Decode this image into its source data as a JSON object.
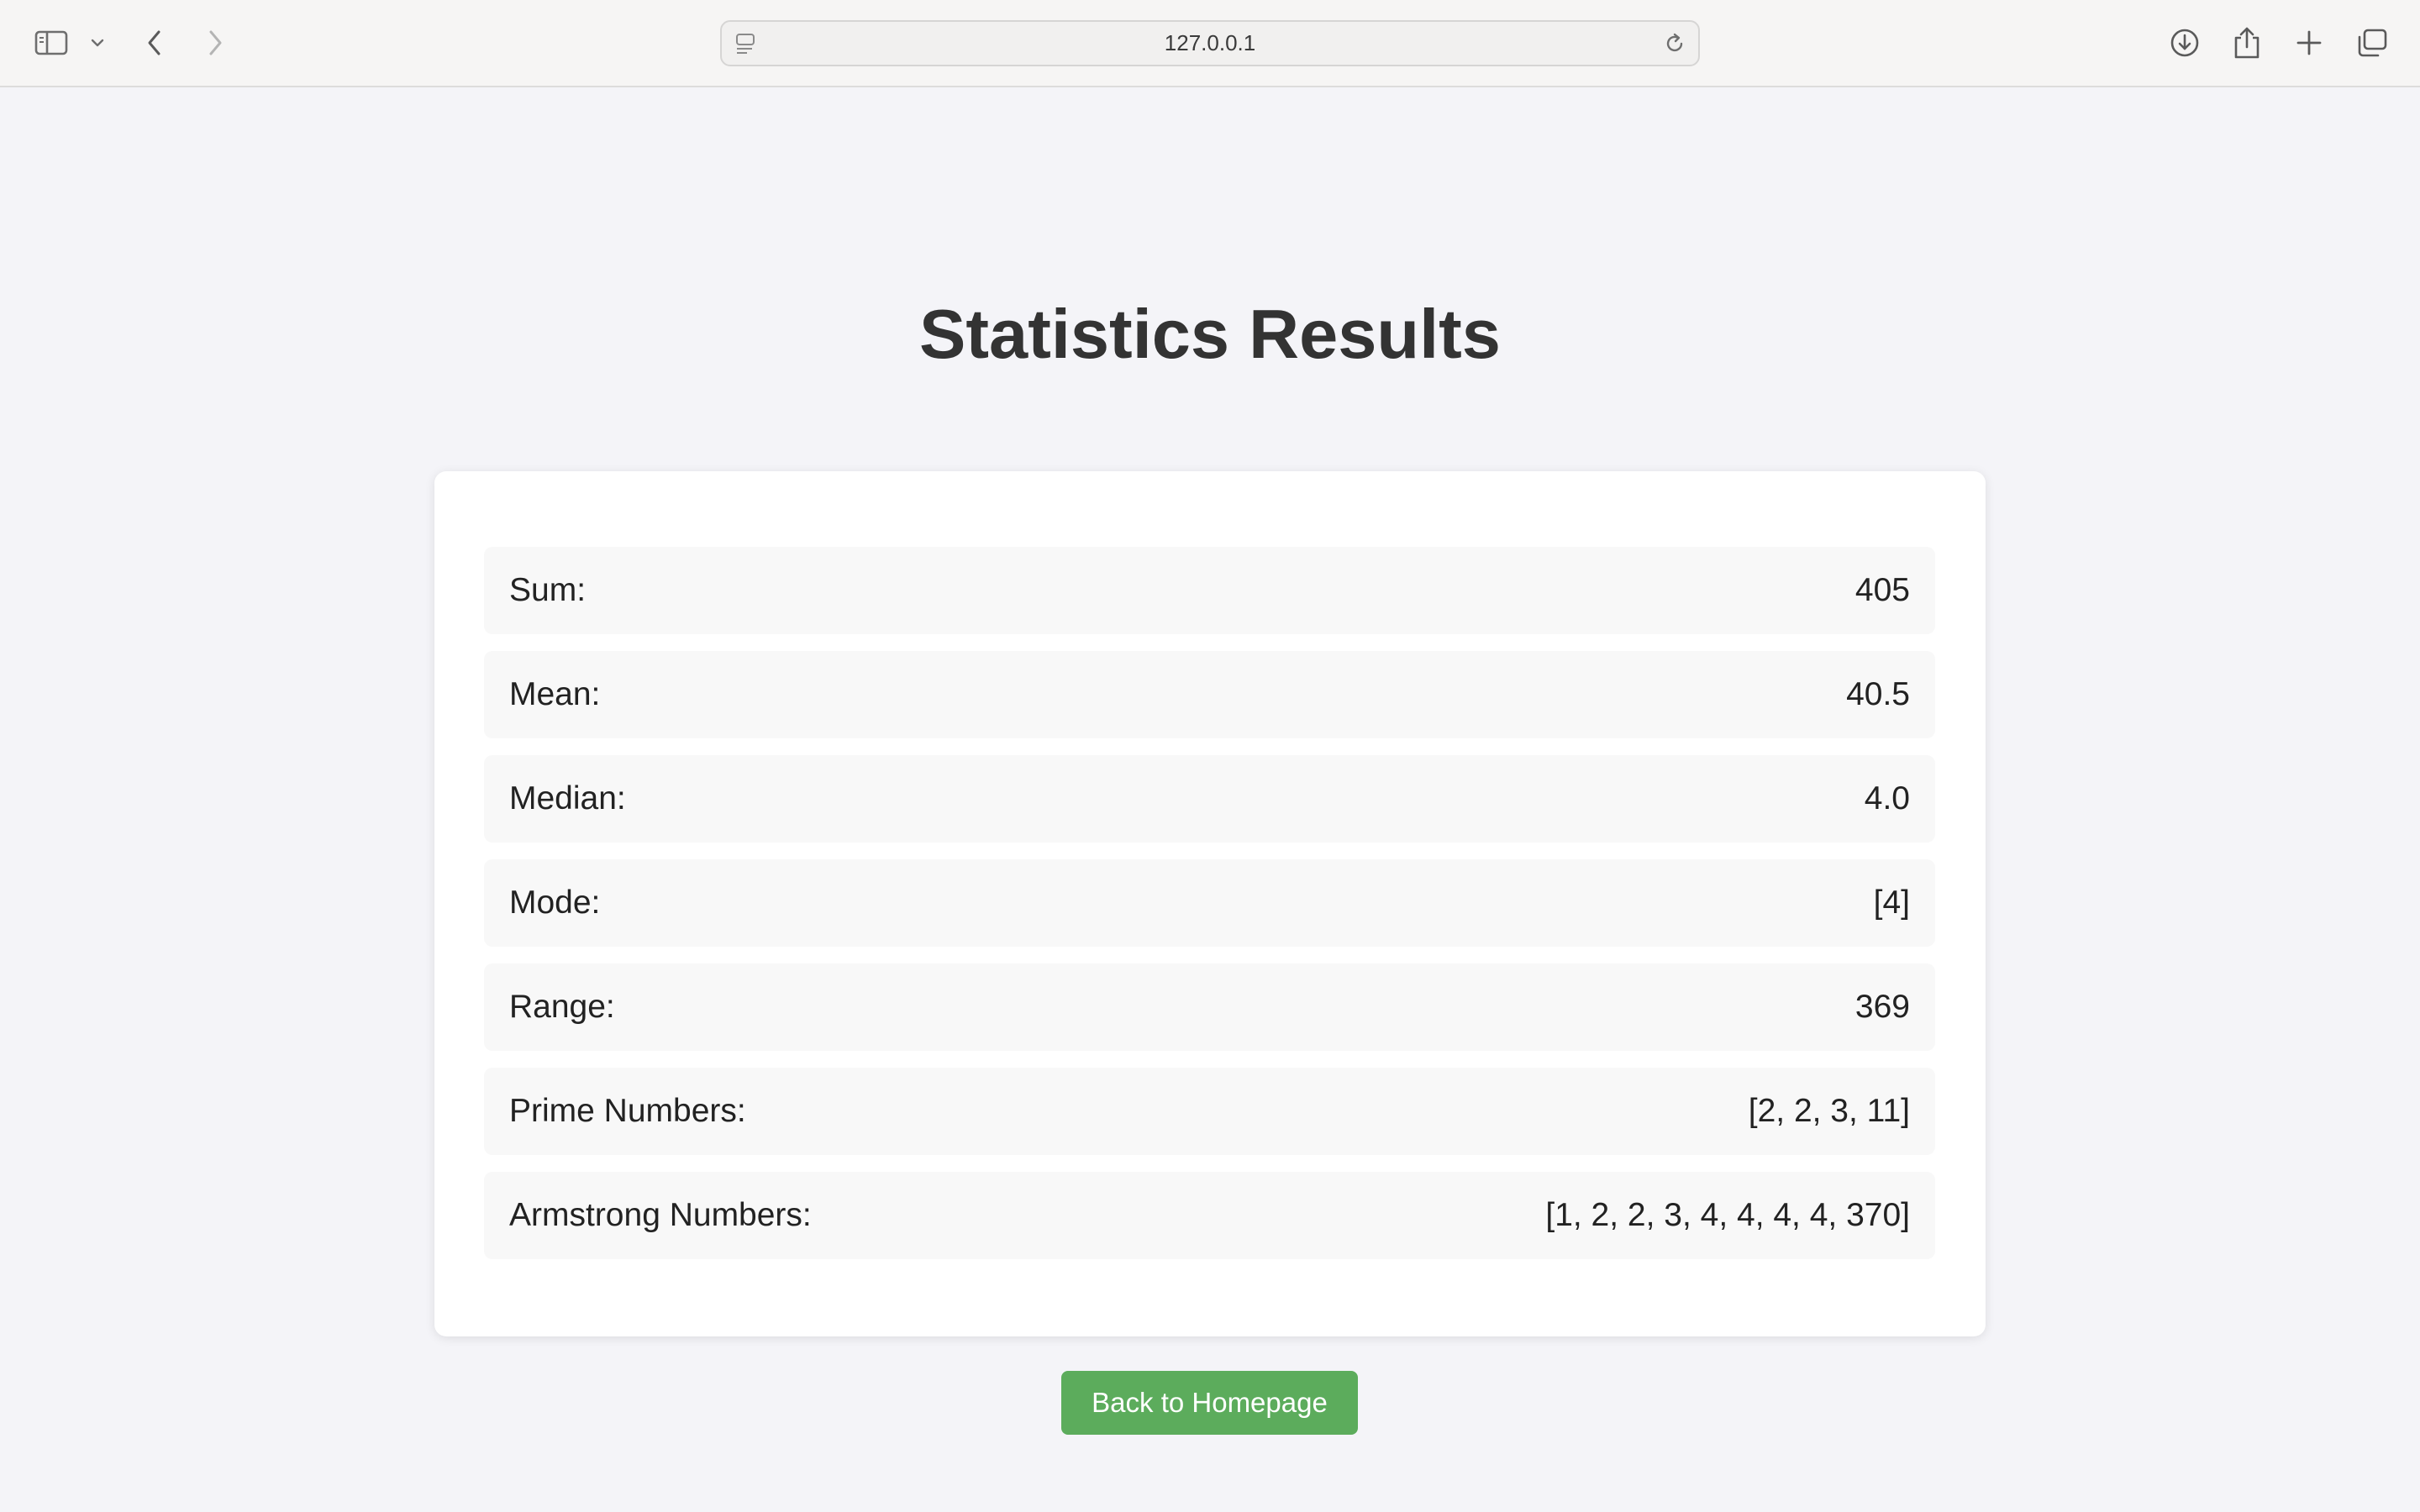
{
  "browser": {
    "url": "127.0.0.1",
    "icons": {
      "sidebar": "sidebar-icon",
      "sidebar_menu": "chevron-down-icon",
      "back": "chevron-left-icon",
      "forward": "chevron-right-icon",
      "page": "page-icon",
      "reload": "reload-icon",
      "downloads": "download-icon",
      "share": "share-icon",
      "new_tab": "plus-icon",
      "tabs": "tab-overview-icon"
    }
  },
  "page": {
    "title": "Statistics Results",
    "stats": [
      {
        "label": "Sum:",
        "value": "405"
      },
      {
        "label": "Mean:",
        "value": "40.5"
      },
      {
        "label": "Median:",
        "value": "4.0"
      },
      {
        "label": "Mode:",
        "value": "[4]"
      },
      {
        "label": "Range:",
        "value": "369"
      },
      {
        "label": "Prime Numbers:",
        "value": "[2, 2, 3, 11]"
      },
      {
        "label": "Armstrong Numbers:",
        "value": "[1, 2, 2, 3, 4, 4, 4, 4, 370]"
      }
    ],
    "back_button": "Back to Homepage"
  },
  "colors": {
    "background": "#f4f4f8",
    "card": "#ffffff",
    "row": "#f8f8f8",
    "button": "#5cac5c",
    "title": "#333333"
  }
}
